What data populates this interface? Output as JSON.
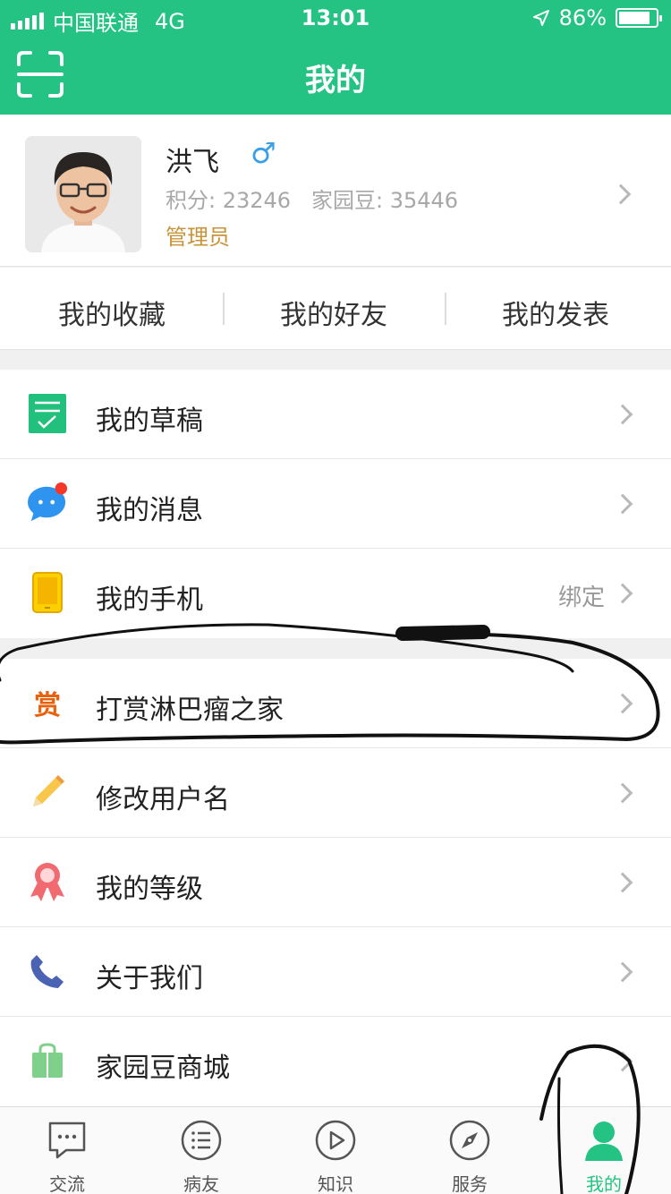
{
  "status_bar": {
    "carrier": "中国联通",
    "network": "4G",
    "time": "13:01",
    "battery": "86%",
    "battery_level": 0.86
  },
  "nav": {
    "title": "我的"
  },
  "profile": {
    "name": "洪飞",
    "gender_symbol": "♂",
    "points": "积分: 23246",
    "beans": "家园豆: 35446",
    "role": "管理员"
  },
  "quick_links": [
    "我的收藏",
    "我的好友",
    "我的发表"
  ],
  "menu_group_1": [
    {
      "label": "我的草稿",
      "icon": "draft-icon"
    },
    {
      "label": "我的消息",
      "icon": "message-icon",
      "badge_color": "#f5372a"
    },
    {
      "label": "我的手机",
      "icon": "phone-icon",
      "extra": "绑定"
    }
  ],
  "menu_group_2": [
    {
      "label": "打赏淋巴瘤之家",
      "icon": "reward-icon",
      "icon_text": "赏"
    },
    {
      "label": "修改用户名",
      "icon": "pencil-icon"
    },
    {
      "label": "我的等级",
      "icon": "medal-icon"
    },
    {
      "label": "关于我们",
      "icon": "phone-handset-icon"
    },
    {
      "label": "家园豆商城",
      "icon": "shopping-bag-icon"
    }
  ],
  "tabs": [
    {
      "label": "交流",
      "icon": "chat-icon",
      "active": false
    },
    {
      "label": "病友",
      "icon": "list-icon",
      "active": false
    },
    {
      "label": "知识",
      "icon": "play-icon",
      "active": false
    },
    {
      "label": "服务",
      "icon": "compass-icon",
      "active": false
    },
    {
      "label": "我的",
      "icon": "person-icon",
      "active": true
    }
  ],
  "colors": {
    "brand": "#24c383",
    "role": "#c9933a",
    "badge": "#f5372a"
  }
}
